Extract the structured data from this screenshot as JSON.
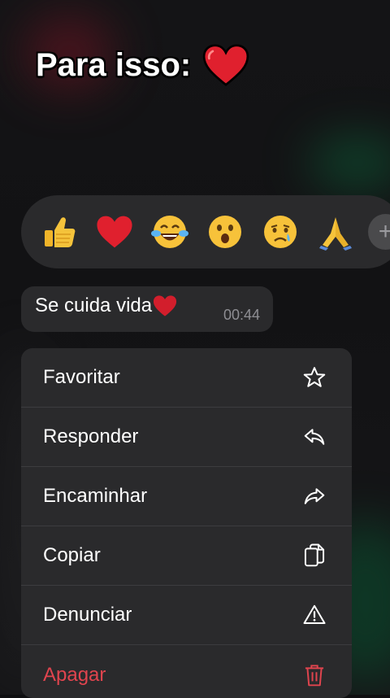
{
  "caption": {
    "text": "Para isso:",
    "emoji": "red-heart-icon"
  },
  "reactions": [
    {
      "icon": "thumbs-up-icon"
    },
    {
      "icon": "red-heart-icon"
    },
    {
      "icon": "tears-of-joy-icon"
    },
    {
      "icon": "surprised-face-icon"
    },
    {
      "icon": "crying-face-icon"
    },
    {
      "icon": "folded-hands-icon"
    },
    {
      "icon": "plus-icon"
    }
  ],
  "message": {
    "text": "Se cuida vida",
    "time": "00:44"
  },
  "menu": [
    {
      "label": "Favoritar",
      "icon": "star-icon"
    },
    {
      "label": "Responder",
      "icon": "reply-icon"
    },
    {
      "label": "Encaminhar",
      "icon": "forward-icon"
    },
    {
      "label": "Copiar",
      "icon": "copy-icon"
    },
    {
      "label": "Denunciar",
      "icon": "warning-icon"
    },
    {
      "label": "Apagar",
      "icon": "trash-icon"
    }
  ],
  "colors": {
    "danger": "#e0444e",
    "surface": "#2a2a2c",
    "heart": "#e0202e"
  }
}
